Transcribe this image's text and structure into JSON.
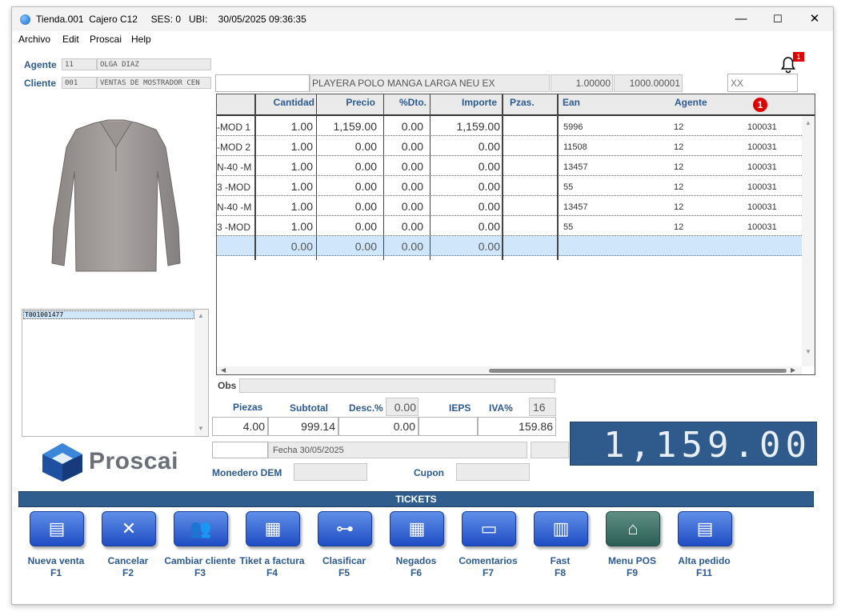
{
  "window": {
    "title": "Tienda.001  Cajero C12     SES: 0   UBI:    30/05/2025 09:36:35",
    "controls": {
      "minimize": "—",
      "maximize": "☐",
      "close": "✕"
    }
  },
  "menu": [
    "Archivo",
    "Edit",
    "Proscai",
    "Help"
  ],
  "header": {
    "agente_label": "Agente",
    "agente_code": "11",
    "agente_name": "OLGA DIAZ",
    "cliente_label": "Cliente",
    "cliente_code": "001",
    "cliente_name": "VENTAS DE MOSTRADOR CEN",
    "product_desc": "PLAYERA POLO MANGA LARGA NEU EX",
    "qty_field": "1.00000",
    "price_field": "1000.00001",
    "xx_field": "XX",
    "notification_count": "1"
  },
  "grid": {
    "columns": [
      "Cantidad",
      "Precio",
      "%Dto.",
      "Importe",
      "Pzas.",
      "Ean",
      "Agente"
    ],
    "header_badge": "1",
    "rows": [
      {
        "desc": "-MOD 1",
        "cantidad": "1.00",
        "precio": "1,159.00",
        "dto": "0.00",
        "importe": "1,159.00",
        "pzas": "",
        "ean": "5996",
        "agente": "12",
        "code": "100031"
      },
      {
        "desc": "-MOD 2",
        "cantidad": "1.00",
        "precio": "0.00",
        "dto": "0.00",
        "importe": "0.00",
        "pzas": "",
        "ean": "11508",
        "agente": "12",
        "code": "100031"
      },
      {
        "desc": "N-40  -M",
        "cantidad": "1.00",
        "precio": "0.00",
        "dto": "0.00",
        "importe": "0.00",
        "pzas": "",
        "ean": "13457",
        "agente": "12",
        "code": "100031"
      },
      {
        "desc": "3  -MOD",
        "cantidad": "1.00",
        "precio": "0.00",
        "dto": "0.00",
        "importe": "0.00",
        "pzas": "",
        "ean": "55",
        "agente": "12",
        "code": "100031"
      },
      {
        "desc": "N-40  -M",
        "cantidad": "1.00",
        "precio": "0.00",
        "dto": "0.00",
        "importe": "0.00",
        "pzas": "",
        "ean": "13457",
        "agente": "12",
        "code": "100031"
      },
      {
        "desc": "3  -MOD",
        "cantidad": "1.00",
        "precio": "0.00",
        "dto": "0.00",
        "importe": "0.00",
        "pzas": "",
        "ean": "55",
        "agente": "12",
        "code": "100031"
      },
      {
        "desc": "",
        "cantidad": "0.00",
        "precio": "0.00",
        "dto": "0.00",
        "importe": "0.00",
        "pzas": "",
        "ean": "",
        "agente": "",
        "code": ""
      }
    ]
  },
  "ticket_list": {
    "items": [
      "T001001477"
    ]
  },
  "brand": {
    "name": "Proscai"
  },
  "totals": {
    "obs_label": "Obs",
    "piezas_label": "Piezas",
    "subtotal_label": "Subtotal",
    "desc_label": "Desc.%",
    "desc_pct": "0.00",
    "ieps_label": "IEPS",
    "iva_label": "IVA%",
    "iva_pct": "16",
    "piezas": "4.00",
    "subtotal": "999.14",
    "descuento": "0.00",
    "iva": "159.86",
    "fecha": "Fecha 30/05/2025",
    "monedero_label": "Monedero DEM",
    "cupon_label": "Cupon",
    "grand_total": "1,159.00"
  },
  "tickets_bar": "TICKETS",
  "function_buttons": [
    {
      "label": "Nueva venta",
      "key": "F1",
      "icon": "new-sale-icon"
    },
    {
      "label": "Cancelar",
      "key": "F2",
      "icon": "cancel-icon"
    },
    {
      "label": "Cambiar cliente",
      "key": "F3",
      "icon": "users-icon"
    },
    {
      "label": "Tiket a factura",
      "key": "F4",
      "icon": "invoice-icon"
    },
    {
      "label": "Clasificar",
      "key": "F5",
      "icon": "classify-icon"
    },
    {
      "label": "Negados",
      "key": "F6",
      "icon": "grid-icon"
    },
    {
      "label": "Comentarios",
      "key": "F7",
      "icon": "comments-icon"
    },
    {
      "label": "Fast",
      "key": "F8",
      "icon": "fast-icon"
    },
    {
      "label": "Menu POS",
      "key": "F9",
      "icon": "home-icon"
    },
    {
      "label": "Alta pedido",
      "key": "F11",
      "icon": "new-order-icon"
    }
  ]
}
